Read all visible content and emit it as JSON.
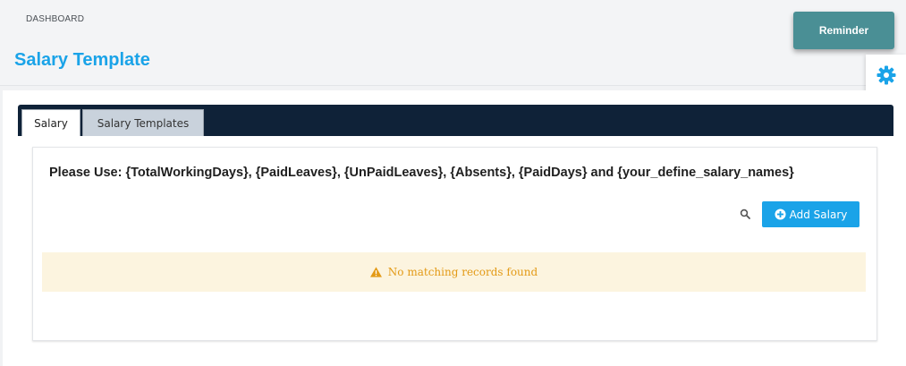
{
  "header": {
    "breadcrumb": "DASHBOARD",
    "title": "Salary Template"
  },
  "reminder_label": "Reminder",
  "tabs": [
    {
      "label": "Salary",
      "active": true
    },
    {
      "label": "Salary Templates",
      "active": false
    }
  ],
  "panel": {
    "hint": "Please Use: {TotalWorkingDays}, {PaidLeaves}, {UnPaidLeaves}, {Absents}, {PaidDays} and {your_define_salary_names}",
    "add_button_label": "Add Salary",
    "empty_message": "No matching records found"
  },
  "colors": {
    "accent": "#1aa3e8",
    "tab_bar": "#0f2238",
    "reminder": "#4a8f95",
    "warning_bg": "#fcf4df",
    "warning_text": "#e39a16"
  },
  "icons": {
    "settings": "gear-icon",
    "search": "search-icon",
    "add": "plus-circle-icon",
    "warning": "warning-icon"
  }
}
